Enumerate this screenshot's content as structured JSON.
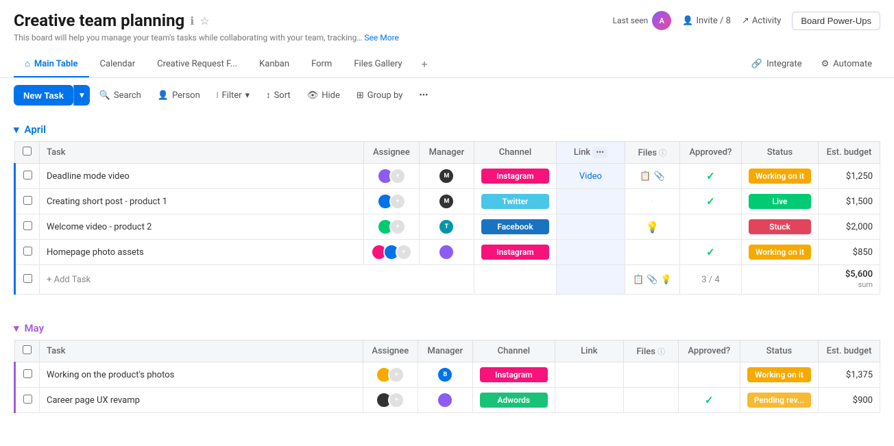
{
  "header": {
    "title": "Creative team planning",
    "desc": "This board will help you manage your team's tasks while collaborating with your team, tracking…",
    "see_more": "See More",
    "last_seen_label": "Last seen",
    "invite_label": "Invite / 8",
    "activity_label": "Activity",
    "powerups_label": "Board Power-Ups"
  },
  "tabs": [
    {
      "label": "Main Table",
      "icon": "⌂",
      "active": true
    },
    {
      "label": "Calendar",
      "active": false
    },
    {
      "label": "Creative Request F...",
      "active": false
    },
    {
      "label": "Kanban",
      "active": false
    },
    {
      "label": "Form",
      "active": false
    },
    {
      "label": "Files Gallery",
      "active": false
    }
  ],
  "tabs_right": [
    {
      "label": "Integrate",
      "icon": "🔗"
    },
    {
      "label": "Automate",
      "icon": "⚙"
    }
  ],
  "toolbar": {
    "new_task": "New Task",
    "search": "Search",
    "person": "Person",
    "filter": "Filter",
    "sort": "Sort",
    "hide": "Hide",
    "group_by": "Group by"
  },
  "april_group": {
    "label": "April",
    "color": "#0073ea",
    "columns": [
      "Task",
      "Assignee",
      "Manager",
      "Channel",
      "Link",
      "Files",
      "Approved?",
      "Status",
      "Est. budget"
    ],
    "rows": [
      {
        "task": "Deadline mode video",
        "manager_color": "#333",
        "channel": "Instagram",
        "channel_class": "channel-instagram",
        "link": "Video",
        "has_files": true,
        "approved": true,
        "status": "Working on it",
        "status_class": "status-working",
        "budget": "$1,250"
      },
      {
        "task": "Creating short post - product 1",
        "manager_color": "#333",
        "channel": "Twitter",
        "channel_class": "channel-twitter",
        "link": "",
        "has_files": false,
        "approved": true,
        "status": "Live",
        "status_class": "status-live",
        "budget": "$1,500"
      },
      {
        "task": "Welcome video - product 2",
        "manager_color": "#333",
        "channel": "Facebook",
        "channel_class": "channel-facebook",
        "link": "",
        "has_files": false,
        "approved": false,
        "status": "Stuck",
        "status_class": "status-stuck",
        "budget": "$2,000"
      },
      {
        "task": "Homepage photo assets",
        "manager_color": "#333",
        "channel": "Instagram",
        "channel_class": "channel-instagram",
        "link": "",
        "has_files": false,
        "approved": true,
        "status": "Working on it",
        "status_class": "status-working",
        "budget": "$850"
      }
    ],
    "add_task": "+ Add Task",
    "summary_approved": "3 / 4",
    "summary_budget": "$5,600",
    "summary_label": "sum"
  },
  "may_group": {
    "label": "May",
    "color": "#a25ddc",
    "columns": [
      "Task",
      "Assignee",
      "Manager",
      "Channel",
      "Link",
      "Files",
      "Approved?",
      "Status",
      "Est. budget"
    ],
    "rows": [
      {
        "task": "Working on the product's photos",
        "channel": "Instagram",
        "channel_class": "channel-instagram",
        "link": "",
        "has_files": false,
        "approved": false,
        "status": "Working on it",
        "status_class": "status-working",
        "budget": "$1,375"
      },
      {
        "task": "Career page UX revamp",
        "channel": "Adwords",
        "channel_class": "channel-adwords",
        "link": "",
        "has_files": false,
        "approved": true,
        "status": "Pending rev...",
        "status_class": "status-pending",
        "budget": "$900"
      }
    ]
  }
}
